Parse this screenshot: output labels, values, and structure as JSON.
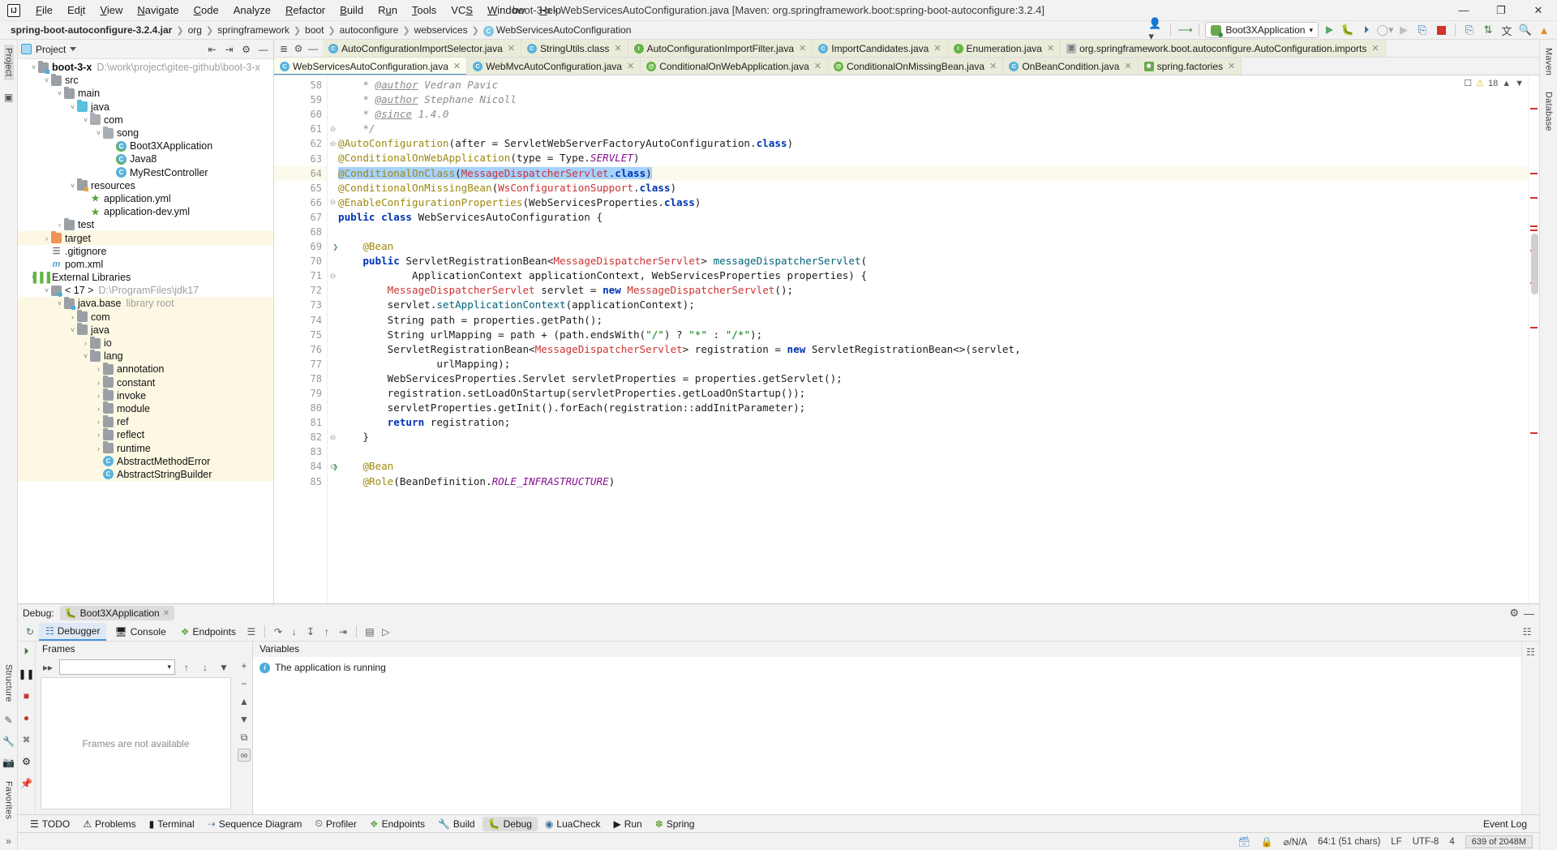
{
  "window": {
    "title": "boot-3-x - WebServicesAutoConfiguration.java [Maven: org.springframework.boot:spring-boot-autoconfigure:3.2.4]",
    "minimize": "—",
    "maximize": "❐",
    "close": "✕",
    "logo": "IJ"
  },
  "menu": [
    {
      "label": "File"
    },
    {
      "label": "Edit"
    },
    {
      "label": "View"
    },
    {
      "label": "Navigate"
    },
    {
      "label": "Code"
    },
    {
      "label": "Analyze"
    },
    {
      "label": "Refactor"
    },
    {
      "label": "Build"
    },
    {
      "label": "Run"
    },
    {
      "label": "Tools"
    },
    {
      "label": "VCS"
    },
    {
      "label": "Window"
    },
    {
      "label": "Help"
    }
  ],
  "breadcrumbs": [
    {
      "label": "spring-boot-autoconfigure-3.2.4.jar",
      "bold": true
    },
    {
      "label": "org"
    },
    {
      "label": "springframework"
    },
    {
      "label": "boot"
    },
    {
      "label": "autoconfigure"
    },
    {
      "label": "webservices"
    },
    {
      "label": "WebServicesAutoConfiguration",
      "icon": "class-icon"
    }
  ],
  "toolbar": {
    "run_config": "Boot3XApplication",
    "run_tooltip": "Run",
    "debug_tooltip": "Debug",
    "coverage_tooltip": "Run with Coverage",
    "profiler_tooltip": "Profiler",
    "stop_tooltip": "Stop",
    "search_icon": "magnify-icon",
    "update_icon": "update-icon",
    "translate_icon": "translate-icon"
  },
  "project_panel": {
    "title": "Project",
    "rail_label": "Project",
    "tree": [
      {
        "depth": 0,
        "arrow": "v",
        "icon": "folder-module",
        "label": "boot-3-x",
        "bold": true,
        "sub": "D:\\work\\project\\gitee-github\\boot-3-x"
      },
      {
        "depth": 1,
        "arrow": "v",
        "icon": "folder",
        "label": "src"
      },
      {
        "depth": 2,
        "arrow": "v",
        "icon": "folder",
        "label": "main"
      },
      {
        "depth": 3,
        "arrow": "v",
        "icon": "folder-source",
        "label": "java"
      },
      {
        "depth": 4,
        "arrow": "v",
        "icon": "package",
        "label": "com"
      },
      {
        "depth": 5,
        "arrow": "v",
        "icon": "package",
        "label": "song"
      },
      {
        "depth": 6,
        "arrow": "",
        "icon": "class-run",
        "label": "Boot3XApplication"
      },
      {
        "depth": 6,
        "arrow": "",
        "icon": "class-run",
        "label": "Java8"
      },
      {
        "depth": 6,
        "arrow": "",
        "icon": "class",
        "label": "MyRestController"
      },
      {
        "depth": 3,
        "arrow": "v",
        "icon": "folder-resource",
        "label": "resources"
      },
      {
        "depth": 4,
        "arrow": "",
        "icon": "yml",
        "label": "application.yml"
      },
      {
        "depth": 4,
        "arrow": "",
        "icon": "yml",
        "label": "application-dev.yml"
      },
      {
        "depth": 2,
        "arrow": ">",
        "icon": "folder",
        "label": "test"
      },
      {
        "depth": 1,
        "arrow": ">",
        "icon": "folder-excluded",
        "label": "target",
        "highlight": true
      },
      {
        "depth": 1,
        "arrow": "",
        "icon": "gitignore",
        "label": ".gitignore"
      },
      {
        "depth": 1,
        "arrow": "",
        "icon": "maven",
        "label": "pom.xml"
      },
      {
        "depth": 0,
        "arrow": "v",
        "icon": "libraries",
        "label": "External Libraries"
      },
      {
        "depth": 1,
        "arrow": "v",
        "icon": "jdk",
        "label": "< 17 >",
        "sub": "D:\\ProgramFiles\\jdk17"
      },
      {
        "depth": 2,
        "arrow": "v",
        "icon": "folder-module",
        "label": "java.base",
        "sub": "library root",
        "highlight": true
      },
      {
        "depth": 3,
        "arrow": ">",
        "icon": "folder",
        "label": "com",
        "highlight": true
      },
      {
        "depth": 3,
        "arrow": "v",
        "icon": "folder",
        "label": "java",
        "highlight": true
      },
      {
        "depth": 4,
        "arrow": ">",
        "icon": "folder",
        "label": "io",
        "highlight": true
      },
      {
        "depth": 4,
        "arrow": "v",
        "icon": "folder",
        "label": "lang",
        "highlight": true
      },
      {
        "depth": 5,
        "arrow": ">",
        "icon": "folder",
        "label": "annotation",
        "highlight": true
      },
      {
        "depth": 5,
        "arrow": ">",
        "icon": "folder",
        "label": "constant",
        "highlight": true
      },
      {
        "depth": 5,
        "arrow": ">",
        "icon": "folder",
        "label": "invoke",
        "highlight": true
      },
      {
        "depth": 5,
        "arrow": ">",
        "icon": "folder",
        "label": "module",
        "highlight": true
      },
      {
        "depth": 5,
        "arrow": ">",
        "icon": "folder",
        "label": "ref",
        "highlight": true
      },
      {
        "depth": 5,
        "arrow": ">",
        "icon": "folder",
        "label": "reflect",
        "highlight": true
      },
      {
        "depth": 5,
        "arrow": ">",
        "icon": "folder",
        "label": "runtime",
        "highlight": true
      },
      {
        "depth": 5,
        "arrow": "",
        "icon": "class",
        "label": "AbstractMethodError",
        "highlight": true
      },
      {
        "depth": 5,
        "arrow": "",
        "icon": "class",
        "label": "AbstractStringBuilder",
        "highlight": true
      }
    ]
  },
  "editor": {
    "tabs_row1": [
      {
        "label": "AutoConfigurationImportSelector.java",
        "icon": "class",
        "closable": true
      },
      {
        "label": "StringUtils.class",
        "icon": "class",
        "closable": true
      },
      {
        "label": "AutoConfigurationImportFilter.java",
        "icon": "interface",
        "closable": true
      },
      {
        "label": "ImportCandidates.java",
        "icon": "class",
        "closable": true
      },
      {
        "label": "Enumeration.java",
        "icon": "interface",
        "closable": true
      },
      {
        "label": "org.springframework.boot.autoconfigure.AutoConfiguration.imports",
        "icon": "file",
        "closable": true
      }
    ],
    "tabs_row2": [
      {
        "label": "WebServicesAutoConfiguration.java",
        "icon": "class",
        "closable": true,
        "active": true
      },
      {
        "label": "WebMvcAutoConfiguration.java",
        "icon": "class",
        "closable": true
      },
      {
        "label": "ConditionalOnWebApplication.java",
        "icon": "annotation",
        "closable": true
      },
      {
        "label": "ConditionalOnMissingBean.java",
        "icon": "annotation",
        "closable": true
      },
      {
        "label": "OnBeanCondition.java",
        "icon": "class",
        "closable": true
      },
      {
        "label": "spring.factories",
        "icon": "spring",
        "closable": true
      }
    ],
    "inspection_count": "18",
    "first_line": 58,
    "lines": [
      {
        "n": 58,
        "html": "    <span class='cm'>* </span><span class='tag'>@author</span><span class='cm'> Vedran Pavic</span>"
      },
      {
        "n": 59,
        "html": "    <span class='cm'>* </span><span class='tag'>@author</span><span class='cm'> Stephane Nicoll</span>"
      },
      {
        "n": 60,
        "html": "    <span class='cm'>* </span><span class='tag'>@since</span><span class='cm'> 1.4.0</span>"
      },
      {
        "n": 61,
        "html": "    <span class='cm'>*/</span>",
        "fold": "⊖"
      },
      {
        "n": 62,
        "html": "<span class='an'>@AutoConfiguration</span>(after = ServletWebServerFactoryAutoConfiguration.<span class='kw'>class</span>)",
        "fold": "⊖"
      },
      {
        "n": 63,
        "html": "<span class='an'>@ConditionalOnWebApplication</span>(type = Type.<span class='it'>SERVLET</span>)"
      },
      {
        "n": 64,
        "html": "<span class='hlsel'><span class='an'>@ConditionalOnClass</span>(<span class='ty'>MessageDispatcherServlet</span>.<span class='kw'>class</span>)</span>",
        "current": true
      },
      {
        "n": 65,
        "html": "<span class='an'>@ConditionalOnMissingBean</span>(<span class='ty'>WsConfigurationSupport</span>.<span class='kw'>class</span>)"
      },
      {
        "n": 66,
        "html": "<span class='an'>@EnableConfigurationProperties</span>(WebServicesProperties.<span class='kw'>class</span>)",
        "fold": "⊖"
      },
      {
        "n": 67,
        "html": "<span class='kw'>public class</span> WebServicesAutoConfiguration {"
      },
      {
        "n": 68,
        "html": ""
      },
      {
        "n": 69,
        "html": "    <span class='an'>@Bean</span>",
        "bean": true
      },
      {
        "n": 70,
        "html": "    <span class='kw'>public</span> ServletRegistrationBean&lt;<span class='ty'>MessageDispatcherServlet</span>&gt; <span class='fn'>messageDispatcherServlet</span>("
      },
      {
        "n": 71,
        "html": "            ApplicationContext applicationContext, WebServicesProperties properties) {",
        "fold": "⊖"
      },
      {
        "n": 72,
        "html": "        <span class='ty'>MessageDispatcherServlet</span> servlet = <span class='kw'>new</span> <span class='ty'>MessageDispatcherServlet</span>();"
      },
      {
        "n": 73,
        "html": "        servlet.<span class='fn'>setApplicationContext</span>(applicationContext);"
      },
      {
        "n": 74,
        "html": "        String path = properties.getPath();"
      },
      {
        "n": 75,
        "html": "        String urlMapping = path + (path.endsWith(<span class='st'>\"/\"</span>) ? <span class='st'>\"*\"</span> : <span class='st'>\"/*\"</span>);"
      },
      {
        "n": 76,
        "html": "        ServletRegistrationBean&lt;<span class='ty'>MessageDispatcherServlet</span>&gt; registration = <span class='kw'>new</span> ServletRegistrationBean&lt;&gt;(servlet,"
      },
      {
        "n": 77,
        "html": "                urlMapping);"
      },
      {
        "n": 78,
        "html": "        WebServicesProperties.Servlet servletProperties = properties.getServlet();"
      },
      {
        "n": 79,
        "html": "        registration.setLoadOnStartup(servletProperties.getLoadOnStartup());"
      },
      {
        "n": 80,
        "html": "        servletProperties.getInit().forEach(registration::addInitParameter);"
      },
      {
        "n": 81,
        "html": "        <span class='kw'>return</span> registration;"
      },
      {
        "n": 82,
        "html": "    }",
        "fold": "⊖"
      },
      {
        "n": 83,
        "html": ""
      },
      {
        "n": 84,
        "html": "    <span class='an'>@Bean</span>",
        "bean": true,
        "fold": "⊖"
      },
      {
        "n": 85,
        "html": "    <span class='an'>@Role</span>(BeanDefinition.<span class='it'>ROLE_INFRASTRUCTURE</span>)"
      }
    ]
  },
  "debug": {
    "label": "Debug:",
    "session": "Boot3XApplication",
    "close": "✕",
    "tabs": [
      {
        "label": "Debugger",
        "icon": "debugger-icon",
        "selected": true
      },
      {
        "label": "Console",
        "icon": "console-icon",
        "selected": false
      },
      {
        "label": "Endpoints",
        "icon": "endpoints-icon",
        "selected": false
      }
    ],
    "frames_title": "Frames",
    "frames_empty": "Frames are not available",
    "variables_title": "Variables",
    "variables_message": "The application is running",
    "settings_icon": "gear-icon",
    "minimize_icon": "minimize-icon",
    "layout_icon": "layout-icon"
  },
  "toolstrip": {
    "items": [
      {
        "label": "TODO",
        "icon": "todo-icon"
      },
      {
        "label": "Problems",
        "icon": "problems-icon"
      },
      {
        "label": "Terminal",
        "icon": "terminal-icon"
      },
      {
        "label": "Sequence Diagram",
        "icon": "sequence-icon"
      },
      {
        "label": "Profiler",
        "icon": "profiler-icon"
      },
      {
        "label": "Endpoints",
        "icon": "endpoints-icon"
      },
      {
        "label": "Build",
        "icon": "build-icon"
      },
      {
        "label": "Debug",
        "icon": "debug-icon",
        "selected": true
      },
      {
        "label": "LuaCheck",
        "icon": "luacheck-icon"
      },
      {
        "label": "Run",
        "icon": "run-icon"
      },
      {
        "label": "Spring",
        "icon": "spring-icon"
      }
    ],
    "event_log": "Event Log"
  },
  "statusbar": {
    "branch": "⌀/N/A",
    "position": "64:1 (51 chars)",
    "line_sep": "LF",
    "encoding": "UTF-8",
    "indent": "4",
    "memory": "639 of 2048M",
    "lock_icon": "lock-icon",
    "db_icon": "database-icon"
  },
  "rails": {
    "left": [
      "Project",
      "Structure",
      "Favorites"
    ],
    "right": [
      "Maven",
      "Database"
    ]
  },
  "colors": {
    "accent": "#4a90d9",
    "tab_active": "#fcfcee",
    "tab_inactive": "#ebebda",
    "highlight": "#fdf8e3",
    "selection": "#a6d2ff",
    "annotation": "#9e880d",
    "keyword": "#0033b3",
    "type": "#cc3333",
    "string": "#067d17"
  }
}
